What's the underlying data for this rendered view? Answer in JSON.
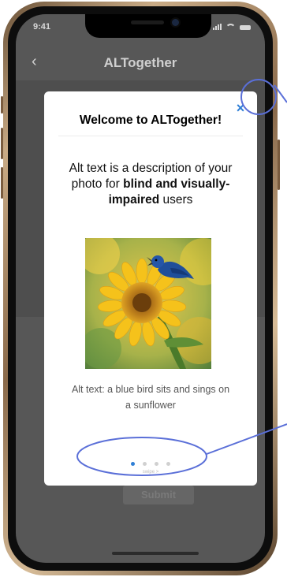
{
  "status_bar": {
    "time": "9:41"
  },
  "header": {
    "back_icon": "chevron-left-icon",
    "title": "ALTogether"
  },
  "modal": {
    "title": "Welcome to ALTogether!",
    "close_label": "×",
    "description_parts": [
      "Alt text is a description of your photo for ",
      "blind and visually-impaired",
      " users"
    ],
    "image_icon": "sunflower-bird-photo",
    "caption": "Alt text: a blue bird sits and sings on a sunflower",
    "pagination": {
      "total": 4,
      "active": 1
    },
    "swipe_hint": "swipe >"
  },
  "footer": {
    "submit_label": "Submit"
  },
  "colors": {
    "accent": "#2f7fd6",
    "annotation": "#5a6fd8",
    "overlay": "#575757"
  }
}
